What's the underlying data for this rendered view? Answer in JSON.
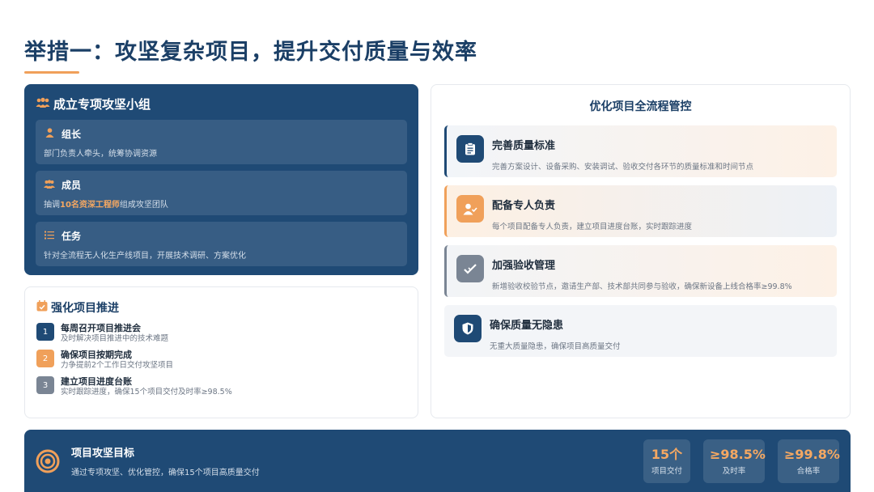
{
  "page": {
    "title": "举措一：攻坚复杂项目，提升交付质量与效率"
  },
  "team": {
    "heading": "成立专项攻坚小组",
    "rows": [
      {
        "icon": "user-icon",
        "title": "组长",
        "desc": "部门负责人牵头，统筹协调资源"
      },
      {
        "icon": "users-icon",
        "title": "成员",
        "desc_prefix": "抽调",
        "desc_highlight": "10名资深工程师",
        "desc_suffix": "组成攻坚团队"
      },
      {
        "icon": "task-list-icon",
        "title": "任务",
        "desc": "针对全流程无人化生产线项目，开展技术调研、方案优化"
      }
    ]
  },
  "push": {
    "heading": "强化项目推进",
    "steps": [
      {
        "num": "1",
        "title": "每周召开项目推进会",
        "desc": "及时解决项目推进中的技术难题"
      },
      {
        "num": "2",
        "title": "确保项目按期完成",
        "desc": "力争提前2个工作日交付攻坚项目"
      },
      {
        "num": "3",
        "title": "建立项目进度台账",
        "desc": "实时跟踪进度，确保15个项目交付及时率≥98.5%"
      }
    ]
  },
  "flow": {
    "heading": "优化项目全流程管控",
    "items": [
      {
        "icon": "clipboard-icon",
        "title": "完善质量标准",
        "desc": "完善方案设计、设备采购、安装调试、验收交付各环节的质量标准和时间节点"
      },
      {
        "icon": "user-check-icon",
        "title": "配备专人负责",
        "desc": "每个项目配备专人负责，建立项目进度台账，实时跟踪进度"
      },
      {
        "icon": "checkmark-icon",
        "title": "加强验收管理",
        "desc": "新增验收校验节点，邀请生产部、技术部共同参与验收，确保新设备上线合格率≥99.8%"
      },
      {
        "icon": "shield-icon",
        "title": "确保质量无隐患",
        "desc": "无重大质量隐患，确保项目高质量交付"
      }
    ]
  },
  "goal": {
    "title": "项目攻坚目标",
    "desc": "通过专项攻坚、优化管控，确保15个项目高质量交付",
    "stats": [
      {
        "value": "15个",
        "label": "项目交付"
      },
      {
        "value": "≥98.5%",
        "label": "及时率"
      },
      {
        "value": "≥99.8%",
        "label": "合格率"
      }
    ]
  },
  "colors": {
    "navy": "#1f4a75",
    "orange": "#f0a05a",
    "gray": "#7a8594"
  }
}
